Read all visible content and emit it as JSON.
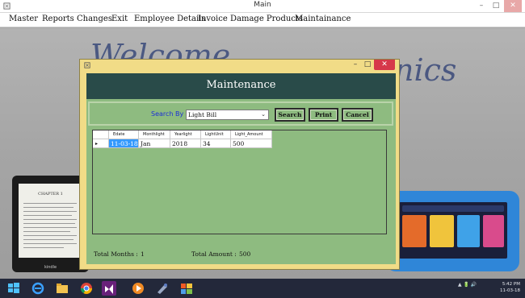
{
  "main_window": {
    "title": "Main",
    "controls": {
      "minimize": "–",
      "maximize": "□",
      "close": "✕"
    }
  },
  "menu": [
    "Master",
    "Reports",
    "Changes",
    "Exit",
    "Employee Details",
    "Invoice",
    "Damage Products",
    "Maintainance"
  ],
  "background": {
    "welcome_left": "Welcome",
    "welcome_right": "nics",
    "kindle_chapter": "CHAPTER 1",
    "kindle_brand": "kindle"
  },
  "dialog": {
    "title": "Maintenance",
    "controls": {
      "minimize": "–",
      "maximize": "□",
      "close": "✕"
    },
    "search": {
      "label": "Search By",
      "selected": "Light Bill",
      "dropdown_arrow": "⌄",
      "buttons": {
        "search": "Search",
        "print": "Print",
        "cancel": "Cancel"
      }
    },
    "grid": {
      "columns": [
        "Edate",
        "Monthlight",
        "Yearlight",
        "LightUnit",
        "Light_Amount"
      ],
      "rows": [
        {
          "indicator": "▸",
          "cells": [
            "11-03-18",
            "Jan",
            "2018",
            "34",
            "500"
          ]
        }
      ]
    },
    "totals": {
      "months_label": "Total Months :",
      "months_value": "1",
      "amount_label": "Total Amount :",
      "amount_value": "500"
    }
  },
  "taskbar": {
    "clock_time": "5:42 PM",
    "clock_date": "11-03-18",
    "tray_icons": "▲ 🔋 🔊"
  },
  "colors": {
    "dialog_frame": "#f1dc87",
    "heading_band": "#294b49",
    "content_bg": "#8ebb80",
    "selected_cell": "#3399ff",
    "search_label": "#1c2fd6",
    "close_button": "#d6384a"
  }
}
